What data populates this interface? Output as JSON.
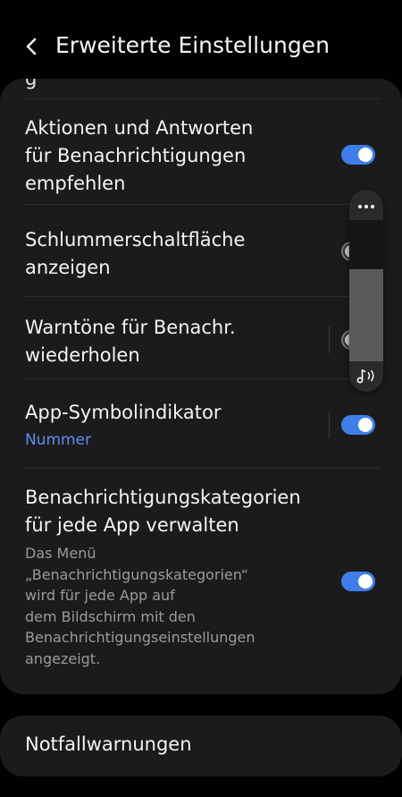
{
  "header": {
    "title": "Erweiterte Einstellungen",
    "back_icon": "chevron-left-icon"
  },
  "partial_row_label": "g",
  "rows": [
    {
      "title": "Aktionen und Antworten\nfür Benachrichtigungen\nempfehlen",
      "toggle": "on"
    },
    {
      "title": "Schlummerschaltfläche\nanzeigen",
      "toggle": "off"
    },
    {
      "title": "Warntöne für Benachr.\nwiederholen",
      "toggle": "off"
    },
    {
      "title": "App-Symbolindikator",
      "subtitle": "Nummer",
      "toggle": "on"
    },
    {
      "title": "Benachrichtigungskategorien\nfür jede App verwalten",
      "description": "Das Menü\n„Benachrichtigungskategorien“\nwird für jede App auf\ndem Bildschirm mit den\nBenachrichtigungseinstellungen\nangezeigt.",
      "toggle": "on"
    }
  ],
  "emergency": {
    "label": "Notfallwarnungen"
  },
  "volume_panel": {
    "level": 0.65,
    "menu_icon": "more-dots-icon",
    "sound_icon": "music-note-sound-icon"
  },
  "colors": {
    "accent": "#3f7ee8",
    "subtitle": "#5d8ff0",
    "card": "#1b1b1d",
    "background": "#010101"
  }
}
